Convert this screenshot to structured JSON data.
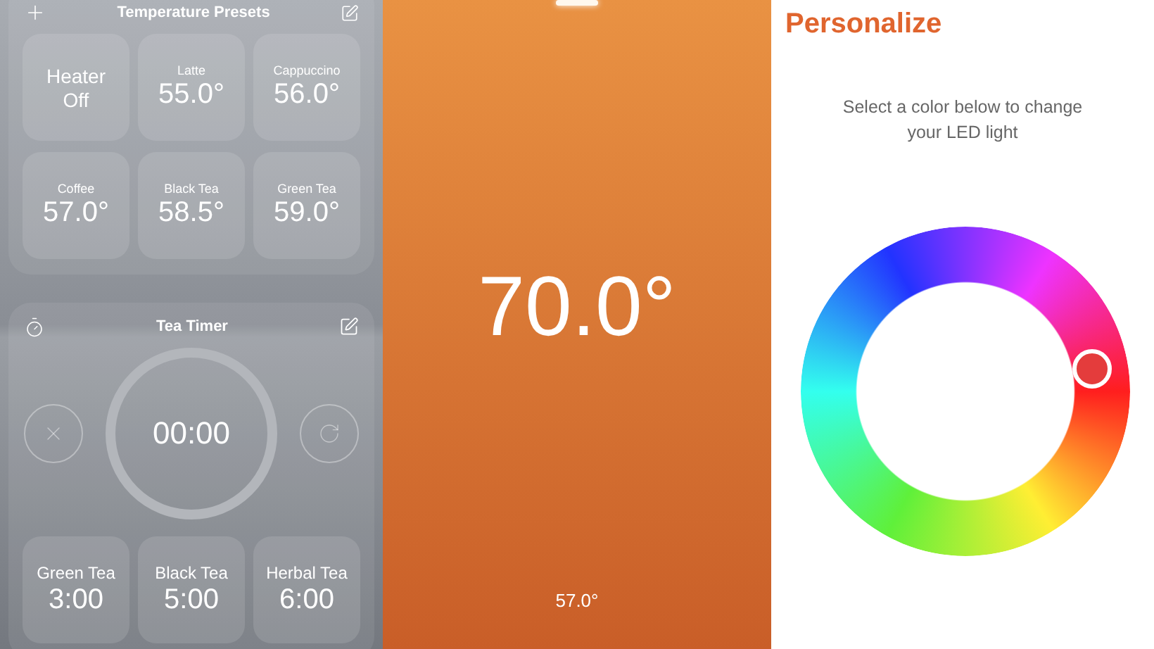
{
  "presets": {
    "title": "Temperature Presets",
    "tiles": [
      {
        "kind": "toggle",
        "label": "Heater",
        "value": "Off"
      },
      {
        "kind": "preset",
        "label": "Latte",
        "value": "55.0°"
      },
      {
        "kind": "preset",
        "label": "Cappuccino",
        "value": "56.0°"
      },
      {
        "kind": "preset",
        "label": "Coffee",
        "value": "57.0°"
      },
      {
        "kind": "preset",
        "label": "Black Tea",
        "value": "58.5°"
      },
      {
        "kind": "preset",
        "label": "Green Tea",
        "value": "59.0°"
      }
    ]
  },
  "timer": {
    "title": "Tea Timer",
    "time": "00:00",
    "presets": [
      {
        "label": "Green Tea",
        "value": "3:00"
      },
      {
        "label": "Black Tea",
        "value": "5:00"
      },
      {
        "label": "Herbal Tea",
        "value": "6:00"
      }
    ]
  },
  "temperature": {
    "target": "70.0°",
    "current": "57.0°"
  },
  "personalize": {
    "title": "Personalize",
    "instruction": "Select a color below to change your LED light"
  }
}
